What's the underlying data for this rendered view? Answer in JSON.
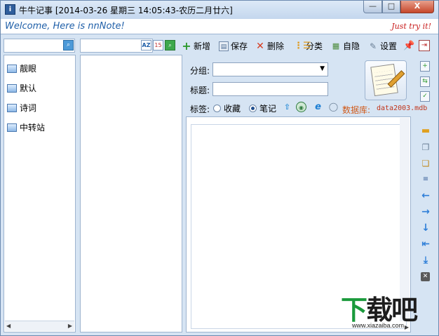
{
  "window": {
    "title": "牛牛记事 [2014-03-26 星期三 14:05:43-农历二月廿六]",
    "app_icon": "i",
    "minimize": "—",
    "maximize": "□",
    "close": "X"
  },
  "banner": {
    "welcome": "Welcome, Here is nnNote!",
    "try_it": "Just try it!"
  },
  "icons": {
    "search_left": "⌕",
    "sort_az": "AZ",
    "calendar": "15",
    "search_mid": "⌕"
  },
  "categories": {
    "items": [
      {
        "label": "靓眼"
      },
      {
        "label": "默认"
      },
      {
        "label": "诗词"
      },
      {
        "label": "中转站"
      }
    ],
    "scroll_left": "◀",
    "scroll_right": "▶"
  },
  "toolbar": {
    "add": {
      "label": "新增",
      "icon": "+"
    },
    "save": {
      "label": "保存",
      "icon": "▤"
    },
    "delete": {
      "label": "删除",
      "icon": "✕"
    },
    "classify": {
      "label": "分类",
      "icon": "⋮☰"
    },
    "hide": {
      "label": "自隐",
      "icon": "▦"
    },
    "settings": {
      "label": "设置",
      "icon": "✎"
    },
    "pin": "📌",
    "exit": "⇥"
  },
  "form": {
    "group_label": "分组:",
    "group_value": "",
    "group_arrow": "▼",
    "title_label": "标题:",
    "title_value": "",
    "tag_label": "标签:",
    "option_favorite": "收藏",
    "option_note": "笔记",
    "up_icon": "⇧",
    "globe_icon": "◉",
    "ie_icon": "e",
    "comment_icon": "◯",
    "db_label": "数据库:",
    "db_name": "data2003.mdb"
  },
  "side_tools": {
    "doc_new": "+",
    "doc_copy": "⇆",
    "doc_check": "✓",
    "folder": "▬",
    "copy": "❐",
    "paste": "❏",
    "indent": "≡",
    "left": "←",
    "right": "→",
    "down": "↓",
    "first": "⇤",
    "download": "⤓",
    "clear": "✕"
  },
  "editor": {
    "content": "",
    "scroll_arrow": "▶"
  },
  "watermark": {
    "logo_a": "下",
    "logo_b": "载吧",
    "url": "www.xiazaiba.com"
  }
}
